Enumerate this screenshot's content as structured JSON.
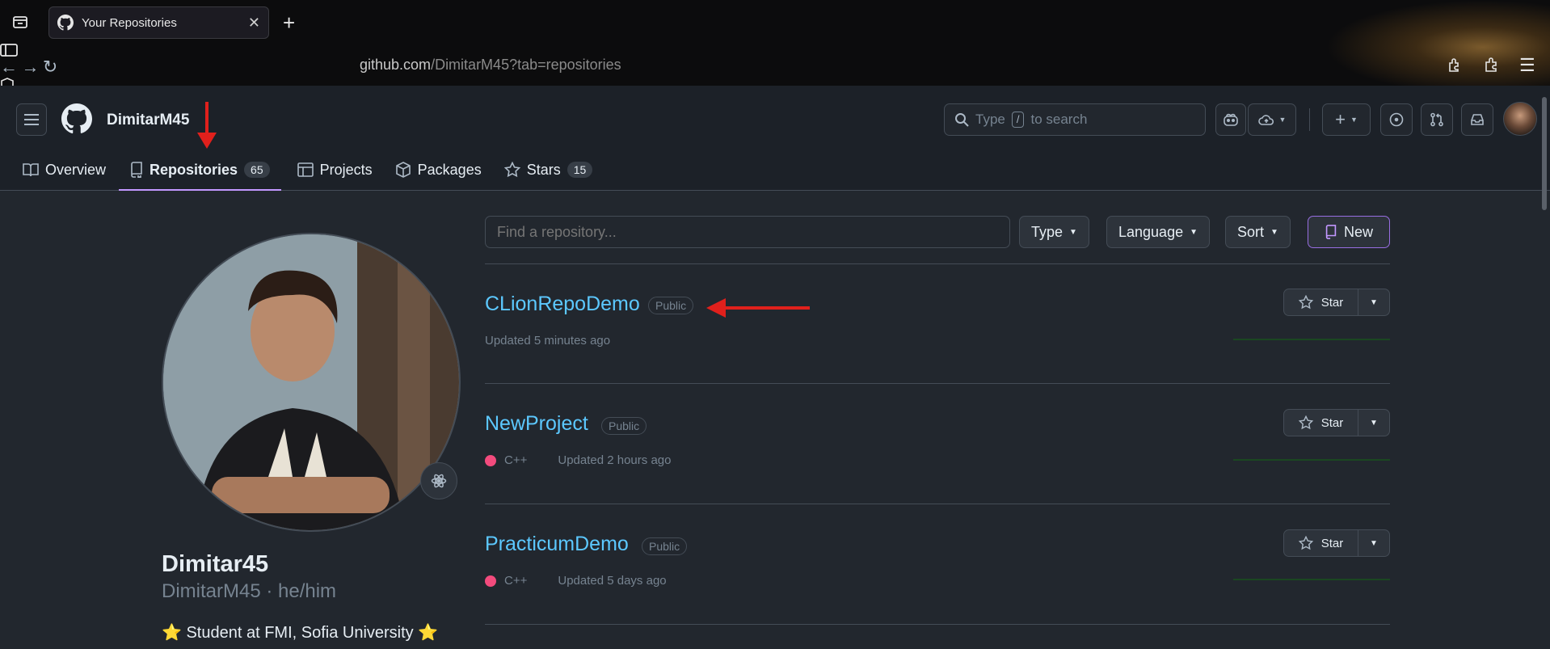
{
  "browser": {
    "tab_title": "Your Repositories",
    "url_host": "github.com",
    "url_path": "/DimitarM45?tab=repositories"
  },
  "header": {
    "username": "DimitarM45",
    "search_prefix": "Type",
    "search_key": "/",
    "search_suffix": "to search"
  },
  "nav": {
    "tabs": [
      {
        "label": "Overview",
        "icon": "book-icon"
      },
      {
        "label": "Repositories",
        "icon": "repo-icon",
        "count": "65",
        "active": true
      },
      {
        "label": "Projects",
        "icon": "table-icon"
      },
      {
        "label": "Packages",
        "icon": "package-icon"
      },
      {
        "label": "Stars",
        "icon": "star-icon",
        "count": "15"
      }
    ]
  },
  "profile": {
    "display_name": "Dimitar45",
    "login_line": "DimitarM45 · he/him",
    "bio": "⭐ Student at FMI, Sofia University ⭐"
  },
  "repos_toolbar": {
    "filter_placeholder": "Find a repository...",
    "type_label": "Type",
    "language_label": "Language",
    "sort_label": "Sort",
    "new_label": "New"
  },
  "repos": [
    {
      "name": "CLionRepoDemo",
      "visibility": "Public",
      "language": "",
      "updated": "Updated 5 minutes ago",
      "star_label": "Star"
    },
    {
      "name": "NewProject",
      "visibility": "Public",
      "language": "C++",
      "updated": "Updated 2 hours ago",
      "star_label": "Star"
    },
    {
      "name": "PracticumDemo",
      "visibility": "Public",
      "language": "C++",
      "updated": "Updated 5 days ago",
      "star_label": "Star"
    }
  ],
  "colors": {
    "accent": "#c297ff",
    "link": "#5cc8ff",
    "cpp_language": "#f34b7d",
    "annotation_arrow": "#e0201c"
  }
}
